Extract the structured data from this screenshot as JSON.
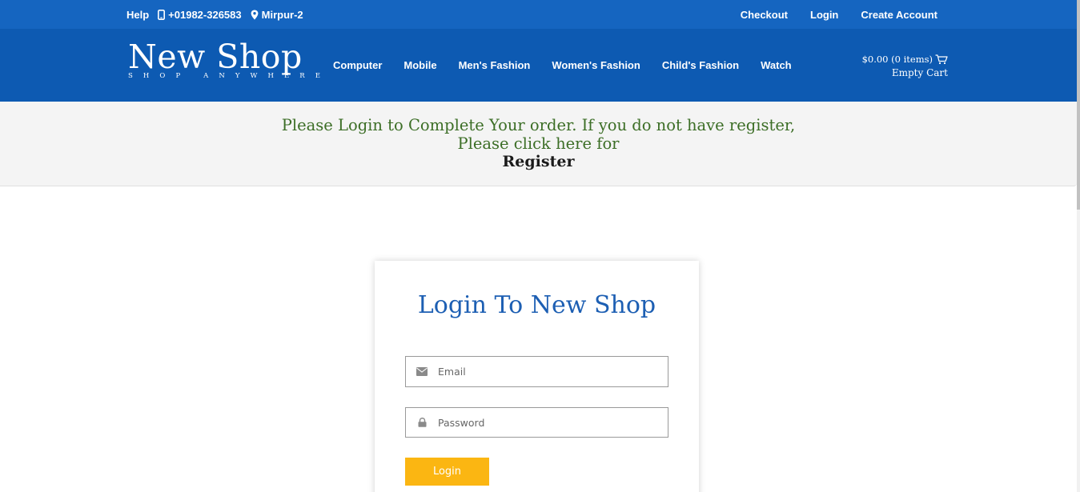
{
  "topbar": {
    "help": "Help",
    "phone": "+01982-326583",
    "location": "Mirpur-2",
    "links": [
      "Checkout",
      "Login",
      "Create Account"
    ]
  },
  "header": {
    "logo_name": "New Shop",
    "logo_tagline": "SHOP ANYWHERE",
    "nav": [
      "Computer",
      "Mobile",
      "Men's Fashion",
      "Women's Fashion",
      "Child's Fashion",
      "Watch"
    ],
    "cart_summary": "$0.00 (0 items)",
    "cart_status": "Empty Cart"
  },
  "notice": {
    "line1": "Please Login to Complete Your order. If you do not have register,",
    "line2": "Please click here for",
    "register_link": "Register"
  },
  "login": {
    "title": "Login To New Shop",
    "email_placeholder": "Email",
    "password_placeholder": "Password",
    "button_label": "Login"
  },
  "icons": {
    "phone": "mobile-phone-icon",
    "location": "map-marker-icon",
    "cart": "shopping-cart-icon",
    "email": "envelope-icon",
    "password": "lock-icon"
  },
  "colors": {
    "topbar": "#1565c0",
    "header": "#0d5ab2",
    "notice_text": "#3c6e26",
    "title": "#1d5fb3",
    "button": "#fbb612"
  }
}
